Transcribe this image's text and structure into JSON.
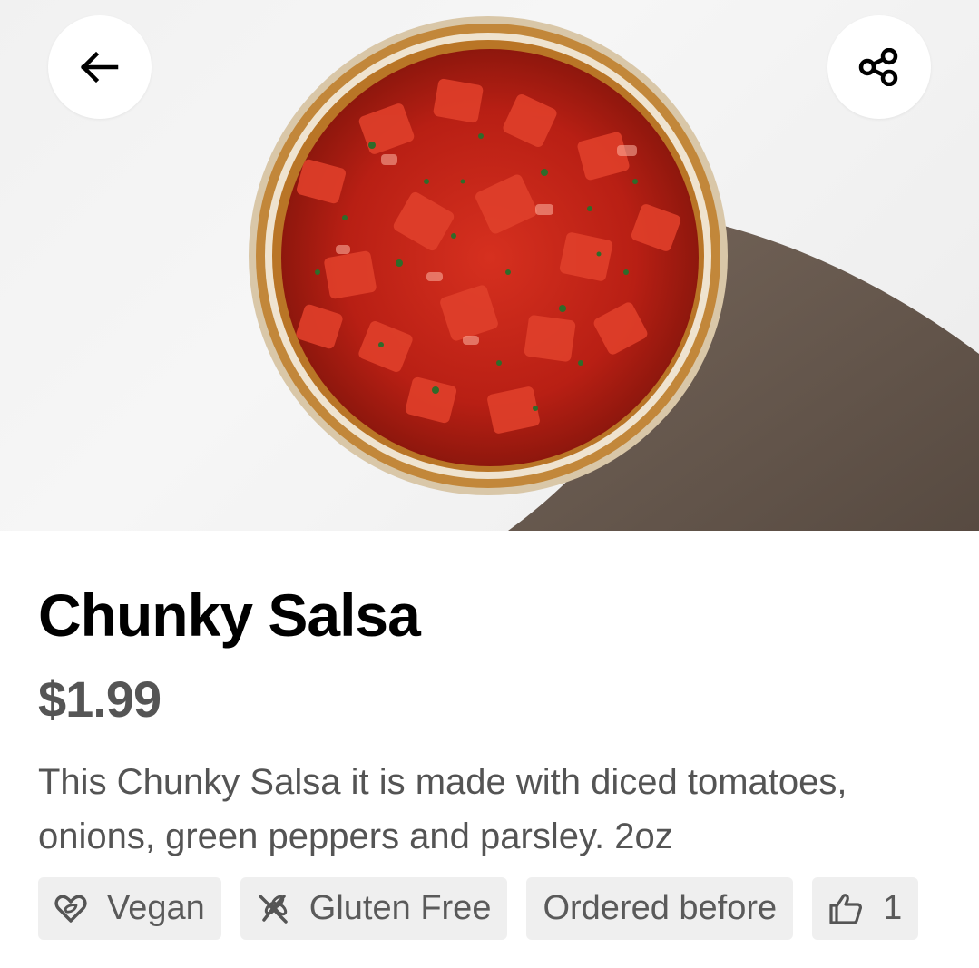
{
  "header": {
    "back_icon": "arrow-left-icon",
    "share_icon": "share-icon"
  },
  "item": {
    "name": "Chunky Salsa",
    "price": "$1.99",
    "description": "This Chunky Salsa it is made with diced tomatoes, onions, green peppers and parsley.  2oz"
  },
  "tags": [
    {
      "label": "Vegan",
      "icon": "heart-leaf-icon"
    },
    {
      "label": "Gluten Free",
      "icon": "wheat-crossed-icon"
    },
    {
      "label": "Ordered before",
      "icon": ""
    },
    {
      "label": "1",
      "icon": "thumbs-up-icon"
    }
  ],
  "colors": {
    "title": "#000000",
    "price": "#555555",
    "description": "#545454",
    "tag_bg": "#efefef",
    "salsa_red": "#c8231a"
  }
}
